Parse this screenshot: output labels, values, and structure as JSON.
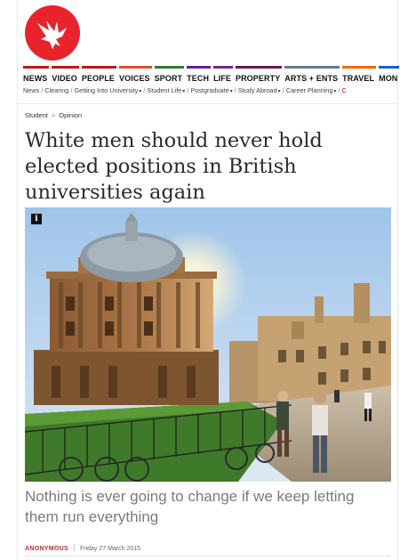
{
  "brand": {
    "logo_icon": "eagle-icon",
    "logo_color": "#e8232b"
  },
  "nav": {
    "items": [
      {
        "label": "NEWS",
        "color": "#b71c1c"
      },
      {
        "label": "VIDEO",
        "color": "#b71c1c"
      },
      {
        "label": "PEOPLE",
        "color": "#b71c1c"
      },
      {
        "label": "VOICES",
        "color": "#d9532c"
      },
      {
        "label": "SPORT",
        "color": "#2e7d32"
      },
      {
        "label": "TECH",
        "color": "#6a1b9a"
      },
      {
        "label": "LIFE",
        "color": "#7b1fa2"
      },
      {
        "label": "PROPERTY",
        "color": "#6d1b4d"
      },
      {
        "label": "ARTS + ENTS",
        "color": "#607d8b"
      },
      {
        "label": "TRAVEL",
        "color": "#ef6c00"
      },
      {
        "label": "MON",
        "color": "#1565c0"
      }
    ]
  },
  "subnav": {
    "items": [
      {
        "label": "News",
        "dropdown": false
      },
      {
        "label": "Clearing",
        "dropdown": false
      },
      {
        "label": "Getting Into University",
        "dropdown": true
      },
      {
        "label": "Student Life",
        "dropdown": true
      },
      {
        "label": "Postgraduate",
        "dropdown": true
      },
      {
        "label": "Study Abroad",
        "dropdown": true
      },
      {
        "label": "Career Planning",
        "dropdown": true
      }
    ],
    "last_partial": "C"
  },
  "breadcrumb": {
    "items": [
      "Student",
      "Opinion"
    ]
  },
  "article": {
    "headline": "White men should never hold elected positions in British universities again",
    "standfirst": "Nothing is ever going to change if we keep letting them run everything",
    "author": "ANONYMOUS",
    "date": "Friday 27 March 2015",
    "image_info_icon": "info-icon",
    "info_label": "i"
  },
  "colors": {
    "author": "#c0282d",
    "standfirst": "#7a7a7a"
  }
}
